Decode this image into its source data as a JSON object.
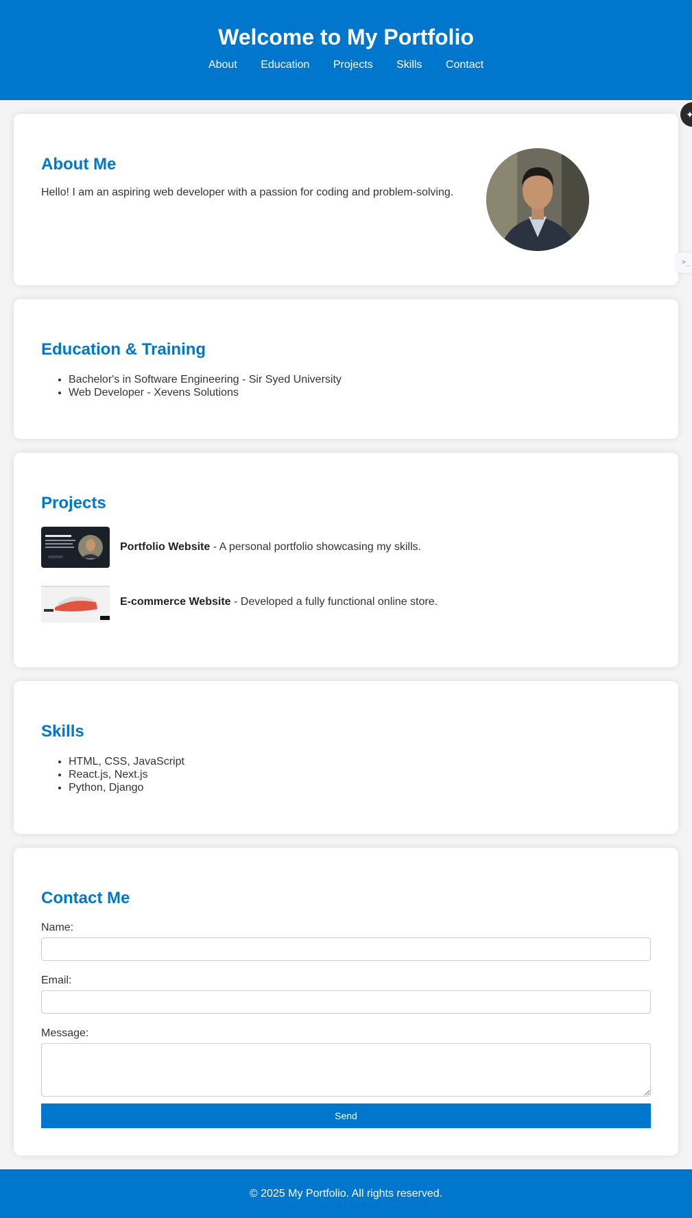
{
  "header": {
    "title": "Welcome to My Portfolio",
    "nav": [
      "About",
      "Education",
      "Projects",
      "Skills",
      "Contact"
    ]
  },
  "about": {
    "heading": "About Me",
    "text": "Hello! I am an aspiring web developer with a passion for coding and problem-solving."
  },
  "education": {
    "heading": "Education & Training",
    "items": [
      "Bachelor's in Software Engineering - Sir Syed University",
      "Web Developer - Xevens Solutions"
    ]
  },
  "projects": {
    "heading": "Projects",
    "items": [
      {
        "name": "Portfolio Website",
        "desc": " - A personal portfolio showcasing my skills."
      },
      {
        "name": "E-commerce Website",
        "desc": " - Developed a fully functional online store."
      }
    ]
  },
  "skills": {
    "heading": "Skills",
    "items": [
      "HTML, CSS, JavaScript",
      "React.js, Next.js",
      "Python, Django"
    ]
  },
  "contact": {
    "heading": "Contact Me",
    "name_label": "Name:",
    "email_label": "Email:",
    "message_label": "Message:",
    "send_label": "Send"
  },
  "footer": {
    "text": "© 2025 My Portfolio. All rights reserved."
  },
  "colors": {
    "primary": "#0077cc",
    "background": "#f4f4f4"
  }
}
